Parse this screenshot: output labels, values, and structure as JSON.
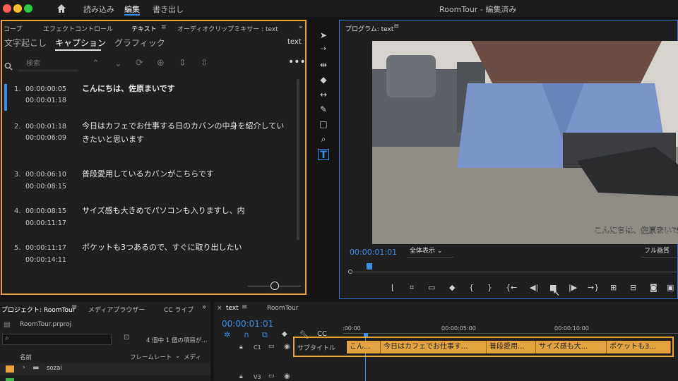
{
  "titlebar": {
    "menus": [
      "読み込み",
      "編集",
      "書き出し"
    ],
    "active_menu": "編集",
    "app_title": "RoomTour - 編集済み"
  },
  "text_panel": {
    "tabs": [
      "コープ",
      "エフェクトコントロール",
      "テキスト",
      "オーディオクリップミキサー : text"
    ],
    "active_tab": "テキスト",
    "subtabs": [
      "文字起こし",
      "キャプション",
      "グラフィック"
    ],
    "active_subtab": "キャプション",
    "track_label": "text",
    "search_placeholder": "検索",
    "captions": [
      {
        "num": "1.",
        "in": "00:00:00:05",
        "out": "00:00:01:18",
        "text": "こんにちは、佐原まいです"
      },
      {
        "num": "2.",
        "in": "00:00:01:18",
        "out": "00:00:06:09",
        "text": "今日はカフェでお仕事する日のカバンの中身を紹介していきたいと思います"
      },
      {
        "num": "3.",
        "in": "00:00:06:10",
        "out": "00:00:08:15",
        "text": "普段愛用しているカバンがこちらです"
      },
      {
        "num": "4.",
        "in": "00:00:08:15",
        "out": "00:00:11:17",
        "text": "サイズ感も大きめでパソコンも入りますし、内"
      },
      {
        "num": "5.",
        "in": "00:00:11:17",
        "out": "00:00:14:11",
        "text": "ポケットも3つあるので、すぐに取り出したい"
      }
    ]
  },
  "program": {
    "title": "プログラム: text",
    "subtitle_overlay": "こんにちは、佐原まいです",
    "timecode": "00:00:01:01",
    "fit": "全体表示",
    "quality": "フル画質"
  },
  "project": {
    "tabs": [
      "プロジェクト: RoomTour",
      "メディアブラウザー",
      "CC ライブ"
    ],
    "file": "RoomTour.prproj",
    "count": "4 個中 1 個の項目が...",
    "columns": [
      "名前",
      "フレームレート",
      "メディ"
    ],
    "items": [
      "sozai"
    ]
  },
  "timeline": {
    "tabs": [
      "text",
      "RoomTour"
    ],
    "timecode": "00:00:01:01",
    "ruler": [
      ":00:00",
      "00:00:05:00",
      "00:00:10:00"
    ],
    "track_c1": "C1",
    "track_v3": "V3",
    "subtitle_track": "サブタイトル",
    "clips": [
      "こん...",
      "今日はカフェでお仕事す...",
      "普段愛用...",
      "サイズ感も大...",
      "ポケットも3..."
    ]
  },
  "colors": {
    "accent": "#e8a33a",
    "blue": "#3a8ee6",
    "clip": "#e3a33f"
  }
}
